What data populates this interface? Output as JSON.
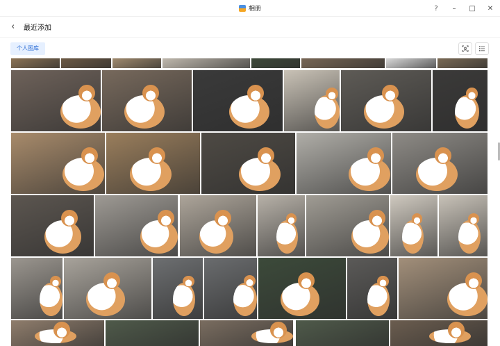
{
  "window": {
    "title": "相册",
    "controls": {
      "help": "?",
      "minimize": "–",
      "maximize": "□",
      "close": "✕"
    }
  },
  "header": {
    "title": "最近添加"
  },
  "toolbar": {
    "library_tab": "个人图库"
  },
  "icons": {
    "app": "photos-app-icon",
    "back": "chevron-left-icon",
    "face": "face-scan-icon",
    "list": "list-view-icon"
  },
  "colors": {
    "accent": "#2f6fd6",
    "tab_bg": "#e6f0ff"
  }
}
